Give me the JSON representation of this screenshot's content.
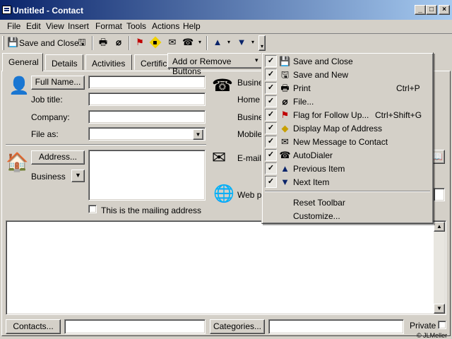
{
  "window": {
    "title": "Untitled - Contact",
    "min": "_",
    "max": "□",
    "close": "×"
  },
  "menubar": [
    "File",
    "Edit",
    "View",
    "Insert",
    "Format",
    "Tools",
    "Actions",
    "Help"
  ],
  "toolbar": {
    "save_close": "Save and Close",
    "add_remove": "Add or Remove Buttons"
  },
  "tabs": [
    "General",
    "Details",
    "Activities",
    "Certific"
  ],
  "form": {
    "full_name_btn": "Full Name...",
    "job_title": "Job title:",
    "company": "Company:",
    "file_as": "File as:",
    "address_btn": "Address...",
    "address_type": "Business",
    "mailing_label": "This is the mailing address",
    "phone_business": "Business",
    "phone_home": "Home",
    "phone_business2": "Busines",
    "phone_mobile": "Mobile",
    "email": "E-mail",
    "web": "Web pa",
    "contacts_btn": "Contacts...",
    "categories_btn": "Categories...",
    "private": "Private",
    "copyright": "© JLMeller"
  },
  "menu": {
    "items": [
      {
        "label": "Save and Close",
        "shortcut": "",
        "icon": "save-close-icon",
        "checked": true
      },
      {
        "label": "Save and New",
        "shortcut": "",
        "icon": "save-new-icon",
        "checked": true
      },
      {
        "label": "Print",
        "shortcut": "Ctrl+P",
        "icon": "printer-icon",
        "checked": true
      },
      {
        "label": "File...",
        "shortcut": "",
        "icon": "paperclip-icon",
        "checked": true
      },
      {
        "label": "Flag for Follow Up...",
        "shortcut": "Ctrl+Shift+G",
        "icon": "flag-icon",
        "checked": true
      },
      {
        "label": "Display Map of Address",
        "shortcut": "",
        "icon": "map-icon",
        "checked": true
      },
      {
        "label": "New Message to Contact",
        "shortcut": "",
        "icon": "new-message-icon",
        "checked": true
      },
      {
        "label": "AutoDialer",
        "shortcut": "",
        "icon": "autodialer-icon",
        "checked": true
      },
      {
        "label": "Previous Item",
        "shortcut": "",
        "icon": "up-arrow-icon",
        "checked": true
      },
      {
        "label": "Next Item",
        "shortcut": "",
        "icon": "down-arrow-icon",
        "checked": true
      }
    ],
    "reset": "Reset Toolbar",
    "customize": "Customize..."
  }
}
